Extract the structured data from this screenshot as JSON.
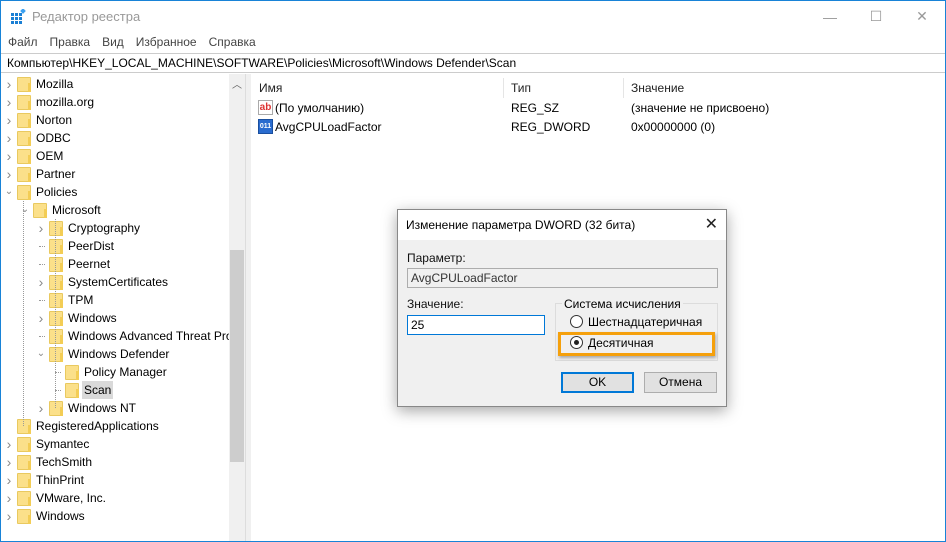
{
  "window": {
    "title": "Редактор реестра",
    "minimize": "—",
    "maximize": "☐",
    "close": "✕"
  },
  "menu": [
    "Файл",
    "Правка",
    "Вид",
    "Избранное",
    "Справка"
  ],
  "address": "Компьютер\\HKEY_LOCAL_MACHINE\\SOFTWARE\\Policies\\Microsoft\\Windows Defender\\Scan",
  "tree": [
    {
      "label": "Mozilla",
      "level": 0,
      "exp": "collapsed"
    },
    {
      "label": "mozilla.org",
      "level": 0,
      "exp": "collapsed"
    },
    {
      "label": "Norton",
      "level": 0,
      "exp": "collapsed"
    },
    {
      "label": "ODBC",
      "level": 0,
      "exp": "collapsed"
    },
    {
      "label": "OEM",
      "level": 0,
      "exp": "collapsed"
    },
    {
      "label": "Partner",
      "level": 0,
      "exp": "collapsed"
    },
    {
      "label": "Policies",
      "level": 0,
      "exp": "expanded"
    },
    {
      "label": "Microsoft",
      "level": 1,
      "exp": "expanded"
    },
    {
      "label": "Cryptography",
      "level": 2,
      "exp": "collapsed"
    },
    {
      "label": "PeerDist",
      "level": 2,
      "exp": "none"
    },
    {
      "label": "Peernet",
      "level": 2,
      "exp": "none"
    },
    {
      "label": "SystemCertificates",
      "level": 2,
      "exp": "collapsed"
    },
    {
      "label": "TPM",
      "level": 2,
      "exp": "none"
    },
    {
      "label": "Windows",
      "level": 2,
      "exp": "collapsed"
    },
    {
      "label": "Windows Advanced Threat Protection",
      "level": 2,
      "exp": "none"
    },
    {
      "label": "Windows Defender",
      "level": 2,
      "exp": "expanded"
    },
    {
      "label": "Policy Manager",
      "level": 3,
      "exp": "none"
    },
    {
      "label": "Scan",
      "level": 3,
      "exp": "none",
      "selected": true
    },
    {
      "label": "Windows NT",
      "level": 2,
      "exp": "collapsed"
    },
    {
      "label": "RegisteredApplications",
      "level": 0,
      "exp": "none"
    },
    {
      "label": "Symantec",
      "level": 0,
      "exp": "collapsed"
    },
    {
      "label": "TechSmith",
      "level": 0,
      "exp": "collapsed"
    },
    {
      "label": "ThinPrint",
      "level": 0,
      "exp": "collapsed"
    },
    {
      "label": "VMware, Inc.",
      "level": 0,
      "exp": "collapsed"
    },
    {
      "label": "Windows",
      "level": 0,
      "exp": "collapsed"
    }
  ],
  "list": {
    "columns": [
      "Имя",
      "Тип",
      "Значение"
    ],
    "rows": [
      {
        "name": "(По умолчанию)",
        "type": "REG_SZ",
        "value": "(значение не присвоено)",
        "icon": "string-value-icon"
      },
      {
        "name": "AvgCPULoadFactor",
        "type": "REG_DWORD",
        "value": "0x00000000 (0)",
        "icon": "dword-value-icon"
      }
    ]
  },
  "dialog": {
    "title": "Изменение параметра DWORD (32 бита)",
    "param_label": "Параметр:",
    "param_value": "AvgCPULoadFactor",
    "value_label": "Значение:",
    "value": "25",
    "base_label": "Система исчисления",
    "hex_label": "Шестнадцатеричная",
    "dec_label": "Десятичная",
    "selected_base": "dec",
    "ok": "OK",
    "cancel": "Отмена",
    "highlight_color": "#f5a00c"
  }
}
